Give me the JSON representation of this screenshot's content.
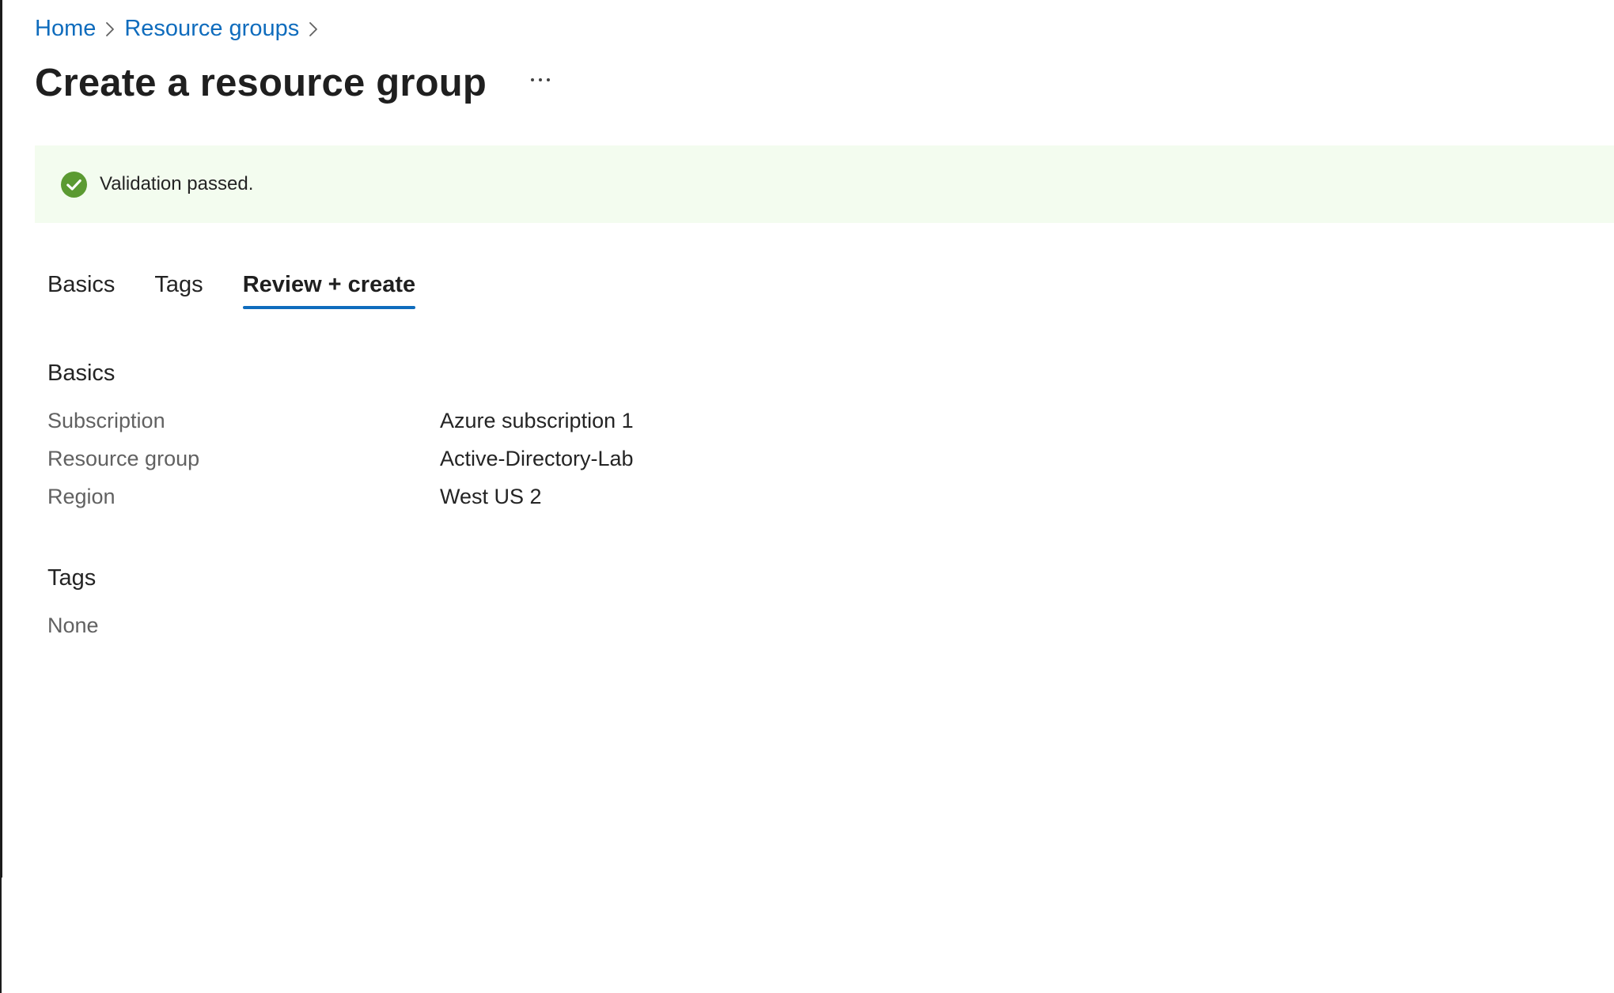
{
  "breadcrumb": {
    "items": [
      {
        "label": "Home"
      },
      {
        "label": "Resource groups"
      }
    ]
  },
  "header": {
    "title": "Create a resource group",
    "more_label": "…"
  },
  "banner": {
    "status": "success",
    "icon": "check-circle-icon",
    "message": "Validation passed.",
    "colors": {
      "background": "#f3fcef",
      "icon": "#5b9a32"
    }
  },
  "tabs": [
    {
      "label": "Basics",
      "active": false
    },
    {
      "label": "Tags",
      "active": false
    },
    {
      "label": "Review + create",
      "active": true
    }
  ],
  "review": {
    "basics": {
      "heading": "Basics",
      "rows": [
        {
          "label": "Subscription",
          "value": "Azure subscription 1"
        },
        {
          "label": "Resource group",
          "value": "Active-Directory-Lab"
        },
        {
          "label": "Region",
          "value": "West US 2"
        }
      ]
    },
    "tags": {
      "heading": "Tags",
      "value": "None"
    }
  },
  "colors": {
    "accent": "#0f6cbd",
    "text": "#242424",
    "muted": "#616161"
  }
}
